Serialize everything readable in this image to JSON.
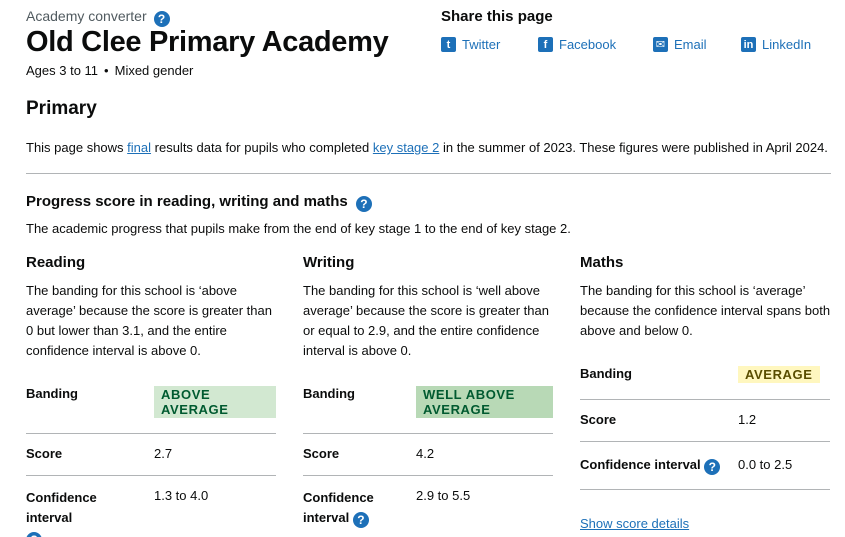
{
  "header": {
    "caption": "Academy converter",
    "school_name": "Old Clee Primary Academy",
    "ages": "Ages 3 to 11",
    "gender": "Mixed gender"
  },
  "share": {
    "title": "Share this page",
    "links": [
      {
        "label": "Twitter",
        "icon": "twitter-icon"
      },
      {
        "label": "Facebook",
        "icon": "facebook-icon"
      },
      {
        "label": "Email",
        "icon": "email-icon"
      },
      {
        "label": "LinkedIn",
        "icon": "linkedin-icon"
      }
    ]
  },
  "phase": "Primary",
  "intro": {
    "before_final": "This page shows ",
    "final_link": "final",
    "middle": " results data for pupils who completed ",
    "ks2_link": "key stage 2",
    "after": " in the summer of 2023. These figures were published in April 2024."
  },
  "progress": {
    "title": "Progress score in reading, writing and maths",
    "description": "The academic progress that pupils make from the end of key stage 1 to the end of key stage 2."
  },
  "subjects": {
    "reading": {
      "name": "Reading",
      "description": "The banding for this school is ‘above average’ because the score is greater than 0 but lower than 3.1, and the entire confidence interval is above 0.",
      "banding_label": "Banding",
      "banding_value": "Above average",
      "score_label": "Score",
      "score": "2.7",
      "ci_label": "Confidence interval",
      "ci": "1.3 to 4.0"
    },
    "writing": {
      "name": "Writing",
      "description": "The banding for this school is ‘well above average’ because the score is greater than or equal to 2.9, and the entire confidence interval is above 0.",
      "banding_label": "Banding",
      "banding_value": "Well above average",
      "score_label": "Score",
      "score": "4.2",
      "ci_label": "Confidence interval",
      "ci": "2.9 to 5.5"
    },
    "maths": {
      "name": "Maths",
      "description": "The banding for this school is ‘average’ because the confidence interval spans both above and below 0.",
      "banding_label": "Banding",
      "banding_value": "Average",
      "score_label": "Score",
      "score": "1.2",
      "ci_label": "Confidence interval",
      "ci": "0.0 to 2.5",
      "show_details": "Show score details"
    }
  },
  "colors": {
    "link": "#1d70b8",
    "text": "#0b0c0c",
    "secondary_text": "#505a5f",
    "tag_above_bg": "#d2e8d1",
    "tag_well_above_bg": "#b8d9b6",
    "tag_green_text": "#005a30",
    "tag_average_bg": "#fff7bf",
    "tag_average_text": "#594d00"
  }
}
